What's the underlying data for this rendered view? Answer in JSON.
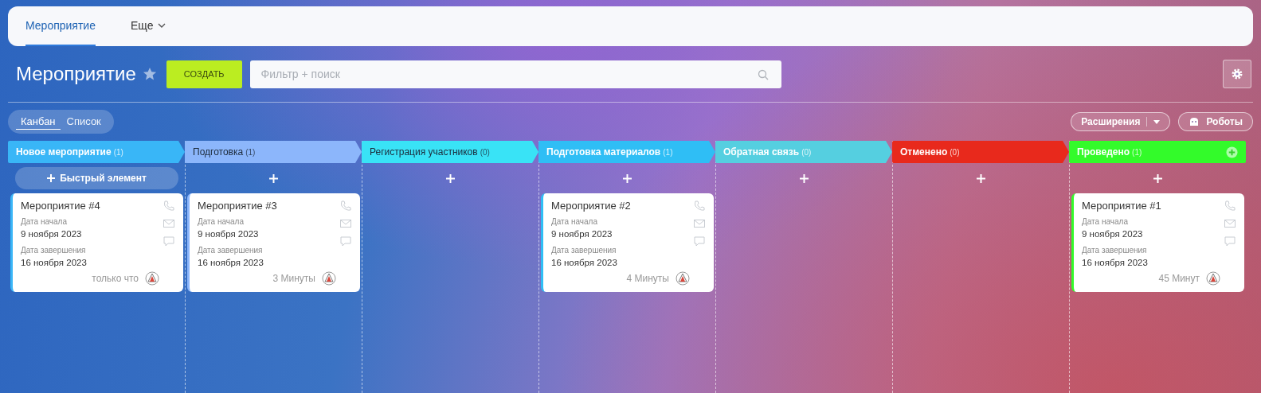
{
  "top_tabs": [
    {
      "label": "Мероприятие",
      "selected": true,
      "kind": "tab"
    },
    {
      "label": "Еще",
      "selected": false,
      "kind": "menu"
    }
  ],
  "title": "Мероприятие",
  "create_button": "СОЗДАТЬ",
  "search": {
    "placeholder": "Фильтр + поиск"
  },
  "views": [
    {
      "label": "Канбан",
      "selected": true
    },
    {
      "label": "Список",
      "selected": false
    }
  ],
  "extensions_button": "Расширения",
  "robots_button": "Роботы",
  "columns": [
    {
      "name": "Новое мероприятие",
      "count": "(1)",
      "color": "#39b6f7",
      "add": {
        "kind": "quick",
        "label": "Быстрый элемент"
      },
      "header_add": false,
      "cards": [
        {
          "title": "Мероприятие #4",
          "start_label": "Дата начала",
          "start": "9 ноября 2023",
          "end_label": "Дата завершения",
          "end": "16 ноября 2023",
          "time": "только что"
        }
      ]
    },
    {
      "name": "Подготовка",
      "count": "(1)",
      "color": "#8cb6fb",
      "add": {
        "kind": "plus"
      },
      "header_add": false,
      "cards": [
        {
          "title": "Мероприятие #3",
          "start_label": "Дата начала",
          "start": "9 ноября 2023",
          "end_label": "Дата завершения",
          "end": "16 ноября 2023",
          "time": "3 Минуты"
        }
      ]
    },
    {
      "name": "Регистрация участников",
      "count": "(0)",
      "color": "#39e3f6",
      "add": {
        "kind": "plus"
      },
      "header_add": false
    },
    {
      "name": "Подготовка материалов",
      "count": "(1)",
      "color": "#2fbef5",
      "add": {
        "kind": "plus"
      },
      "header_add": false,
      "cards": [
        {
          "title": "Мероприятие #2",
          "start_label": "Дата начала",
          "start": "9 ноября 2023",
          "end_label": "Дата завершения",
          "end": "16 ноября 2023",
          "time": "4 Минуты"
        }
      ]
    },
    {
      "name": "Обратная связь",
      "count": "(0)",
      "color": "#55cfe0",
      "add": {
        "kind": "plus"
      },
      "header_add": false
    },
    {
      "name": "Отменено",
      "count": "(0)",
      "color": "#e8291c",
      "add": {
        "kind": "plus"
      },
      "header_add": false
    },
    {
      "name": "Проведено",
      "count": "(1)",
      "color": "#33fb2a",
      "add": {
        "kind": "plus"
      },
      "header_add": true,
      "cards": [
        {
          "title": "Мероприятие #1",
          "start_label": "Дата начала",
          "start": "9 ноября 2023",
          "end_label": "Дата завершения",
          "end": "16 ноября 2023",
          "time": "45 Минут"
        }
      ]
    }
  ]
}
